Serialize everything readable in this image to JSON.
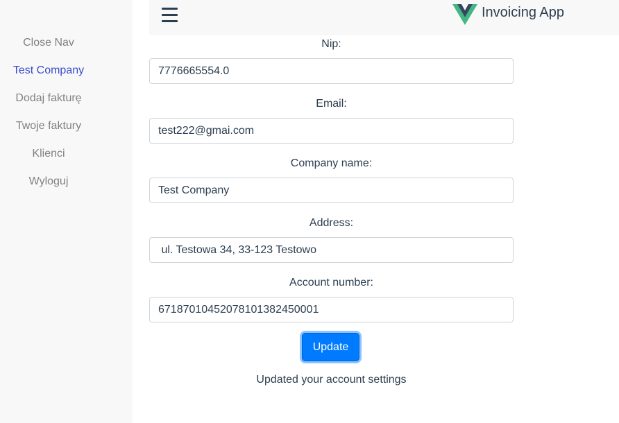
{
  "sidebar": {
    "items": [
      {
        "label": "Close Nav"
      },
      {
        "label": "Test Company"
      },
      {
        "label": "Dodaj fakturę"
      },
      {
        "label": "Twoje faktury"
      },
      {
        "label": "Klienci"
      },
      {
        "label": "Wyloguj"
      }
    ],
    "active_color": "#3b4cca",
    "inactive_color": "#818181"
  },
  "header": {
    "menu_icon": "hamburger-icon",
    "logo_icon": "vue-logo-icon",
    "title": "Invoicing App"
  },
  "form": {
    "nip": {
      "label": "Nip:",
      "value": "7776665554.0"
    },
    "email": {
      "label": "Email:",
      "value": "test222@gmai.com"
    },
    "company_name": {
      "label": "Company name:",
      "value": "Test Company"
    },
    "address": {
      "label": "Address:",
      "value": " ul. Testowa 34, 33-123 Testowo"
    },
    "account_number": {
      "label": "Account number:",
      "value": "67187010452078101382450001"
    },
    "update_label": "Update",
    "status_message": "Updated your account settings"
  },
  "colors": {
    "accent": "#007bff",
    "sidebar_bg": "#f8f8f8",
    "text": "#2c3e50"
  }
}
